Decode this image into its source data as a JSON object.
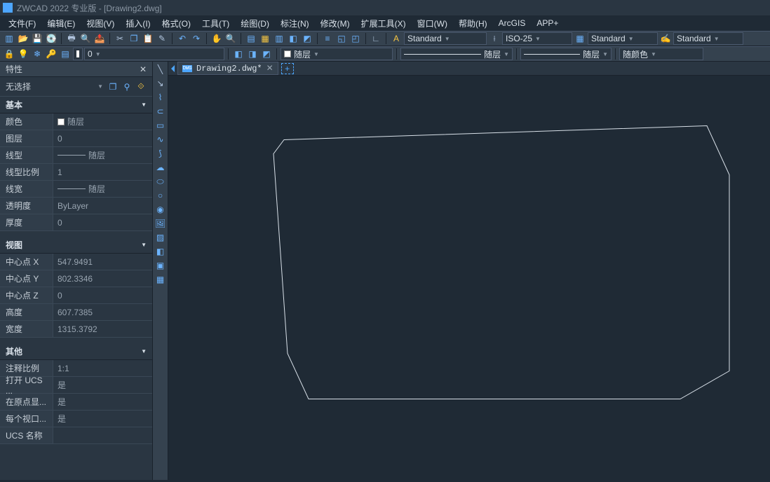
{
  "app": {
    "title": "ZWCAD 2022 专业版 - [Drawing2.dwg]"
  },
  "menu": [
    "文件(F)",
    "编辑(E)",
    "视图(V)",
    "插入(I)",
    "格式(O)",
    "工具(T)",
    "绘图(D)",
    "标注(N)",
    "修改(M)",
    "扩展工具(X)",
    "窗口(W)",
    "帮助(H)",
    "ArcGIS",
    "APP+"
  ],
  "toolbar1": {
    "style_dim": "ISO-25",
    "style_text": "Standard",
    "style_table": "Standard"
  },
  "toolbar2": {
    "layer_zero": "0",
    "bylayer": "随层",
    "linetype": "随层",
    "lineweight": "随层",
    "color": "随颜色"
  },
  "properties": {
    "title": "特性",
    "selector": "无选择",
    "sections": {
      "basic": {
        "title": "基本",
        "rows": [
          {
            "key": "颜色",
            "val": "随层",
            "swatch": true
          },
          {
            "key": "图层",
            "val": "0"
          },
          {
            "key": "线型",
            "val": "随层",
            "prefix_line": true
          },
          {
            "key": "线型比例",
            "val": "1"
          },
          {
            "key": "线宽",
            "val": "随层",
            "prefix_line": true
          },
          {
            "key": "透明度",
            "val": "ByLayer"
          },
          {
            "key": "厚度",
            "val": "0"
          }
        ]
      },
      "view": {
        "title": "视图",
        "rows": [
          {
            "key": "中心点 X",
            "val": "547.9491"
          },
          {
            "key": "中心点 Y",
            "val": "802.3346"
          },
          {
            "key": "中心点 Z",
            "val": "0"
          },
          {
            "key": "高度",
            "val": "607.7385"
          },
          {
            "key": "宽度",
            "val": "1315.3792"
          }
        ]
      },
      "other": {
        "title": "其他",
        "rows": [
          {
            "key": "注释比例",
            "val": "1:1"
          },
          {
            "key": "打开 UCS ...",
            "val": "是"
          },
          {
            "key": "在原点显...",
            "val": "是"
          },
          {
            "key": "每个视口...",
            "val": "是"
          },
          {
            "key": "UCS 名称",
            "val": ""
          }
        ]
      }
    }
  },
  "doc_tabs": {
    "current": "Drawing2.dwg*"
  }
}
